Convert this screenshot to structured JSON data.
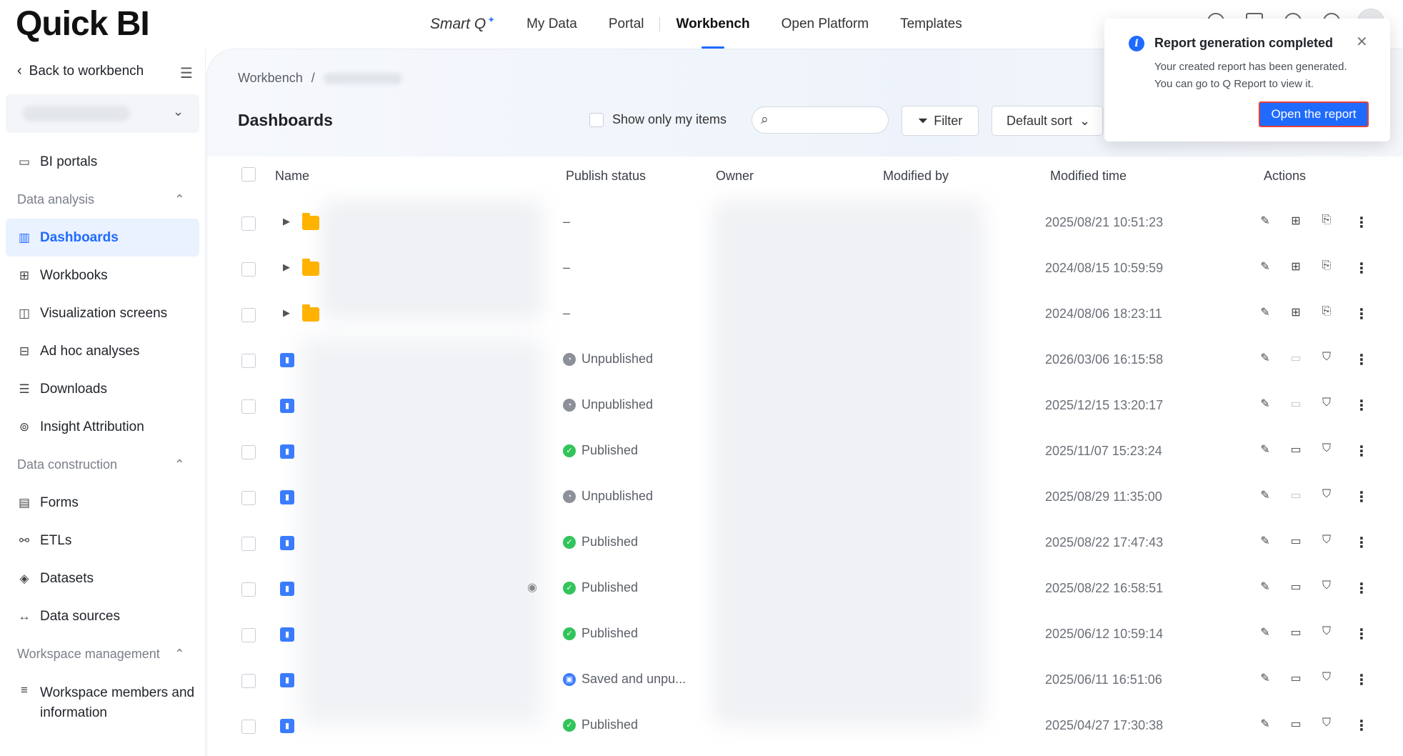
{
  "app": {
    "logo": "Quick BI"
  },
  "topnav": {
    "smartq": "Smart Q",
    "items": [
      "My Data",
      "Portal",
      "Workbench",
      "Open Platform",
      "Templates"
    ]
  },
  "sidebar": {
    "back": "Back to workbench",
    "items": [
      {
        "type": "entry",
        "label": "BI portals",
        "icon": "▭"
      },
      {
        "type": "section",
        "label": "Data analysis"
      },
      {
        "type": "entry",
        "label": "Dashboards",
        "icon": "▥",
        "active": true
      },
      {
        "type": "entry",
        "label": "Workbooks",
        "icon": "⊞"
      },
      {
        "type": "entry",
        "label": "Visualization screens",
        "icon": "◫"
      },
      {
        "type": "entry",
        "label": "Ad hoc analyses",
        "icon": "⊟"
      },
      {
        "type": "entry",
        "label": "Downloads",
        "icon": "☰"
      },
      {
        "type": "entry",
        "label": "Insight Attribution",
        "icon": "⊚"
      },
      {
        "type": "section",
        "label": "Data construction"
      },
      {
        "type": "entry",
        "label": "Forms",
        "icon": "▤"
      },
      {
        "type": "entry",
        "label": "ETLs",
        "icon": "⚯"
      },
      {
        "type": "entry",
        "label": "Datasets",
        "icon": "◈"
      },
      {
        "type": "entry",
        "label": "Data sources",
        "icon": "↔"
      },
      {
        "type": "section",
        "label": "Workspace management"
      },
      {
        "type": "entry",
        "label": "Workspace members and information",
        "icon": "≡"
      }
    ]
  },
  "breadcrumb": {
    "root": "Workbench",
    "sep": "/"
  },
  "page": {
    "title": "Dashboards",
    "show_mine": "Show only my items",
    "filter": "Filter",
    "sort": "Default sort"
  },
  "table": {
    "headers": [
      "Name",
      "Publish status",
      "Owner",
      "Modified by",
      "Modified time",
      "Actions"
    ],
    "rows": [
      {
        "kind": "folder",
        "status": "–",
        "status_type": "none",
        "time": "2025/08/21 10:51:23"
      },
      {
        "kind": "folder",
        "status": "–",
        "status_type": "none",
        "time": "2024/08/15 10:59:59"
      },
      {
        "kind": "folder",
        "status": "–",
        "status_type": "none",
        "time": "2024/08/06 18:23:11"
      },
      {
        "kind": "dashboard",
        "status": "Unpublished",
        "status_type": "unpub",
        "time": "2026/03/06 16:15:58"
      },
      {
        "kind": "dashboard",
        "status": "Unpublished",
        "status_type": "unpub",
        "time": "2025/12/15 13:20:17"
      },
      {
        "kind": "dashboard",
        "status": "Published",
        "status_type": "pub",
        "time": "2025/11/07 15:23:24"
      },
      {
        "kind": "dashboard",
        "status": "Unpublished",
        "status_type": "unpub",
        "time": "2025/08/29 11:35:00"
      },
      {
        "kind": "dashboard",
        "status": "Published",
        "status_type": "pub",
        "time": "2025/08/22 17:47:43"
      },
      {
        "kind": "dashboard",
        "status": "Published",
        "status_type": "pub",
        "time": "2025/08/22 16:58:51",
        "eye": true
      },
      {
        "kind": "dashboard",
        "status": "Published",
        "status_type": "pub",
        "time": "2025/06/12 10:59:14"
      },
      {
        "kind": "dashboard",
        "status": "Saved and unpu...",
        "status_type": "saved",
        "time": "2025/06/11 16:51:06"
      },
      {
        "kind": "dashboard",
        "status": "Published",
        "status_type": "pub",
        "time": "2025/04/27 17:30:38"
      }
    ]
  },
  "toast": {
    "title": "Report generation completed",
    "line1": "Your created report has been generated.",
    "line2": "You can go to Q Report to view it.",
    "button": "Open the report"
  },
  "colors": {
    "accent": "#1f6bff",
    "published": "#31c45a",
    "unpublished": "#8c9199",
    "folder": "#ffb200",
    "highlight": "#e8403a"
  }
}
